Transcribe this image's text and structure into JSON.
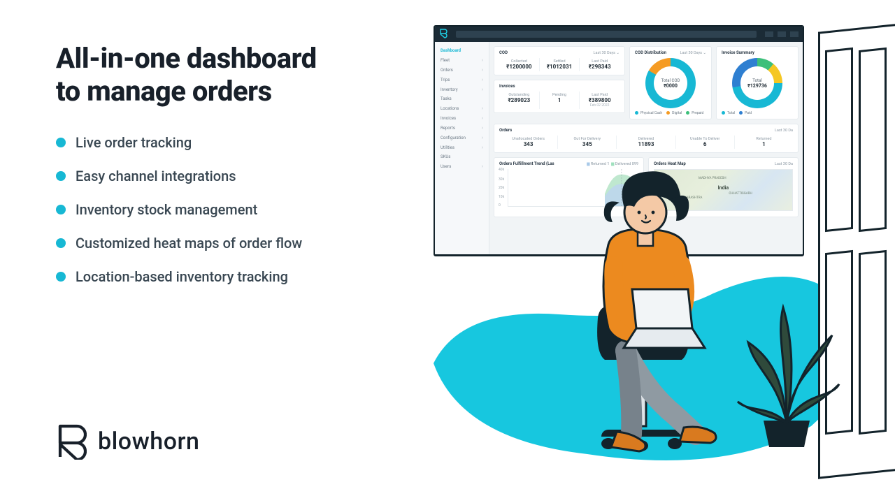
{
  "headline_l1": "All-in-one dashboard",
  "headline_l2": "to manage orders",
  "features": {
    "0": "Live order tracking",
    "1": "Easy channel integrations",
    "2": "Inventory stock management",
    "3": "Customized heat maps of order flow",
    "4": "Location-based inventory tracking"
  },
  "brand": {
    "name": "blowhorn"
  },
  "dashboard": {
    "sidebar": {
      "items": {
        "0": "Dashboard",
        "1": "Fleet",
        "2": "Orders",
        "3": "Trips",
        "4": "Inventory",
        "5": "Tasks",
        "6": "Locations",
        "7": "Invoices",
        "8": "Reports",
        "9": "Configuration",
        "10": "Utilities",
        "11": "SKUs",
        "12": "Users"
      }
    },
    "cod": {
      "title": "COD",
      "range": "Last 30 Days",
      "collected": {
        "label": "Collected",
        "value": "₹1200000"
      },
      "settled": {
        "label": "Settled",
        "value": "₹1012031"
      },
      "lastpaid": {
        "label": "Last Paid",
        "value": "₹298343"
      }
    },
    "invoices": {
      "title": "Invoices",
      "outstanding": {
        "label": "Outstanding",
        "value": "₹289023"
      },
      "pending": {
        "label": "Pending",
        "value": "1"
      },
      "lastpaid": {
        "label": "Last Paid",
        "value": "₹389800",
        "sub": "Feb 02 2022"
      }
    },
    "cod_dist": {
      "title": "COD Distribution",
      "range": "Last 30 Days",
      "center_label": "Total COD",
      "center_value": "₹0000",
      "legend": {
        "0": "Physical Cash",
        "1": "Digital",
        "2": "Prepaid"
      }
    },
    "inv_summary": {
      "title": "Invoice Summary",
      "center_label": "Total",
      "center_value": "₹129736",
      "legend": {
        "0": "Total",
        "1": "Paid"
      }
    },
    "orders": {
      "title": "Orders",
      "range": "Last 30 Da",
      "unallocated": {
        "label": "Unallocated Orders",
        "value": "343"
      },
      "ofd": {
        "label": "Out For Delivery",
        "value": "345"
      },
      "delivered": {
        "label": "Delivered",
        "value": "11893"
      },
      "unable": {
        "label": "Unable To Deliver",
        "value": "6"
      },
      "returned": {
        "label": "Returned",
        "value": "1"
      }
    },
    "trend": {
      "title": "Orders Fulfillment Trend (Las",
      "ylabels": {
        "0": "40k",
        "1": "30k",
        "2": "20k",
        "3": "10k",
        "4": "0"
      },
      "legend": {
        "0": "Returned",
        "1": "Delivered"
      },
      "legend_vals": {
        "0": "1",
        "1": "899"
      }
    },
    "heatmap": {
      "title": "Orders Heat Map",
      "range": "Last 30 Da",
      "country": "India",
      "states": {
        "0": "MADHYA PRADESH",
        "1": "CHHATTISGARH",
        "2": "MAHARASHTRA"
      }
    }
  }
}
